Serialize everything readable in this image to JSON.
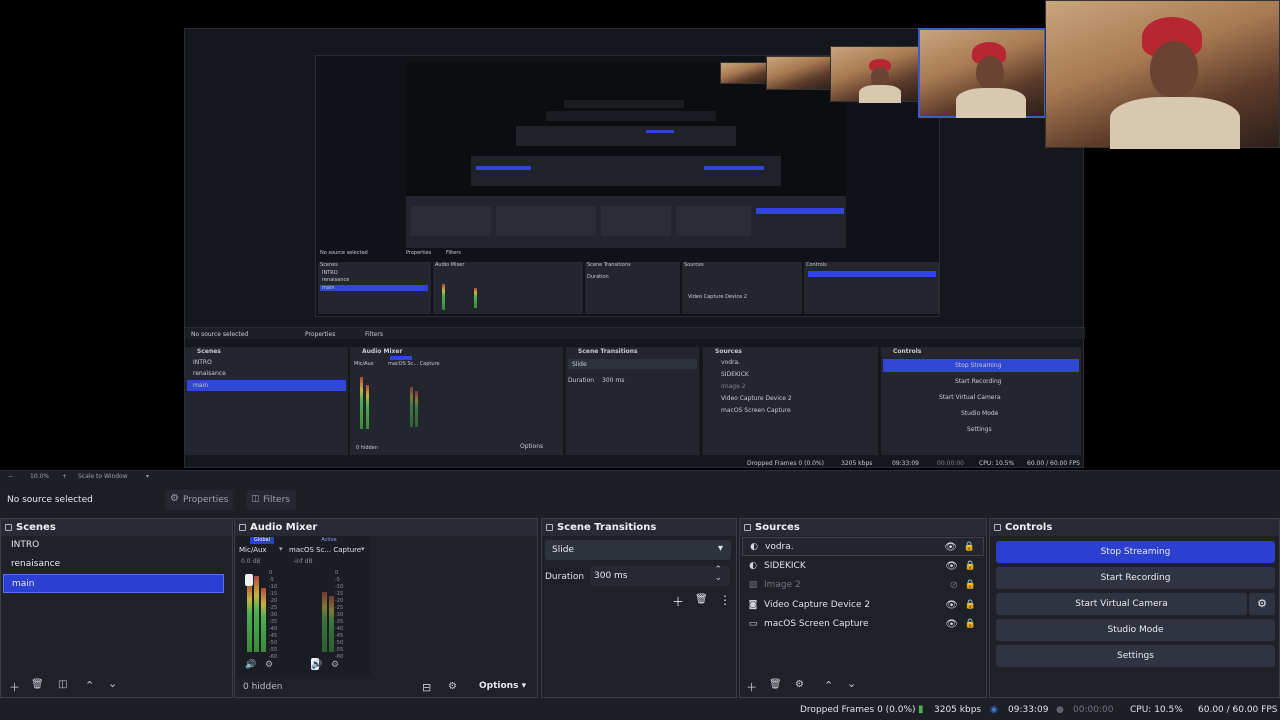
{
  "preview": {
    "inner": {
      "no_source": "No source selected",
      "properties": "Properties",
      "filters": "Filters",
      "zoom": "10.0%",
      "scale": "Scale to Window",
      "scenes_title": "Scenes",
      "scenes": [
        "INTRO",
        "renaisance",
        "main"
      ],
      "mixer_title": "Audio Mixer",
      "mixer_global": "Global",
      "mixer_active": "Active",
      "mixer_ch1": "Mic/Aux",
      "mixer_ch2": "macOS Sc... Capture",
      "hidden": "0 hidden",
      "options": "Options",
      "transitions_title": "Scene Transitions",
      "transition": "Slide",
      "duration_label": "Duration",
      "duration": "300 ms",
      "sources_title": "Sources",
      "sources": [
        "vodra.",
        "SIDEKICK",
        "Image 2",
        "Video Capture Device 2",
        "macOS Screen Capture"
      ],
      "controls_title": "Controls",
      "controls": [
        "Stop Streaming",
        "Start Recording",
        "Start Virtual Camera",
        "Studio Mode",
        "Settings"
      ],
      "dropped": "Dropped Frames 0 (0.0%)",
      "kbps": "3205 kbps",
      "time": "09:33:09",
      "rec": "00:00:00",
      "cpu": "CPU: 10.5%",
      "fps": "60.00 / 60.00 FPS"
    }
  },
  "zoombar": {
    "zoom": "10.0%",
    "scale": "Scale to Window"
  },
  "toolbar": {
    "no_source": "No source selected",
    "properties": "Properties",
    "filters": "Filters"
  },
  "scenes": {
    "title": "Scenes",
    "items": [
      "INTRO",
      "renaisance",
      "main"
    ],
    "selected_index": 2
  },
  "mixer": {
    "title": "Audio Mixer",
    "global_label": "Global",
    "active_label": "Active",
    "ch1": {
      "name": "Mic/Aux",
      "db": "0.0 dB"
    },
    "ch2": {
      "name": "macOS Sc... Capture",
      "db": "-inf dB"
    },
    "scale": [
      "0",
      "-5",
      "-10",
      "-15",
      "-20",
      "-25",
      "-30",
      "-35",
      "-40",
      "-45",
      "-50",
      "-55",
      "-60"
    ],
    "hidden": "0 hidden",
    "options": "Options"
  },
  "transitions": {
    "title": "Scene Transitions",
    "selected": "Slide",
    "duration_label": "Duration",
    "duration": "300 ms"
  },
  "sources": {
    "title": "Sources",
    "items": [
      {
        "name": "vodra.",
        "icon": "browser-icon",
        "visible": true
      },
      {
        "name": "SIDEKICK",
        "icon": "browser-icon",
        "visible": true
      },
      {
        "name": "Image 2",
        "icon": "image-icon",
        "visible": false
      },
      {
        "name": "Video Capture Device 2",
        "icon": "camera-icon",
        "visible": true
      },
      {
        "name": "macOS Screen Capture",
        "icon": "display-icon",
        "visible": true
      }
    ]
  },
  "controls": {
    "title": "Controls",
    "stop_streaming": "Stop Streaming",
    "start_recording": "Start Recording",
    "start_virtual_camera": "Start Virtual Camera",
    "studio_mode": "Studio Mode",
    "settings": "Settings"
  },
  "status": {
    "dropped": "Dropped Frames 0 (0.0%)",
    "kbps": "3205 kbps",
    "stream_time": "09:33:09",
    "rec_time": "00:00:00",
    "cpu": "CPU: 10.5%",
    "fps": "60.00 / 60.00 FPS"
  },
  "colors": {
    "accent": "#2b3fd1",
    "panel": "#272a33",
    "background": "#1d1f26"
  }
}
